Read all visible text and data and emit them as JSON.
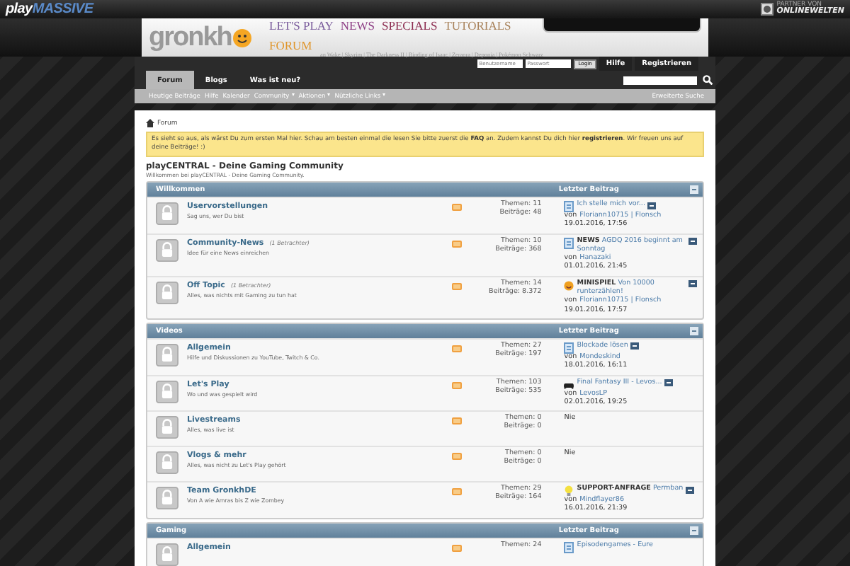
{
  "topbar": {
    "brand_a": "play",
    "brand_b": "MASSIVE",
    "partner_small": "PARTNER VON",
    "partner": "ONLINEWELTEN"
  },
  "header": {
    "logo": "gronkh",
    "nav": [
      {
        "label": "LET'S PLAY",
        "color": "#7a5c9c"
      },
      {
        "label": "NEWS",
        "color": "#8c3c84"
      },
      {
        "label": "SPECIALS",
        "color": "#8c2c50"
      },
      {
        "label": "TUTORIALS",
        "color": "#a8825a"
      },
      {
        "label": "FORUM",
        "color": "#e0962c"
      }
    ],
    "games": "an Wake | Skyrim | The Darkness II | Binding of Isaac | Zeraora | Deponia | Pokémon Schwarz"
  },
  "login": {
    "user_placeholder": "Benutzername",
    "pass_placeholder": "Passwort",
    "button": "Login"
  },
  "top_buttons": [
    "Hilfe",
    "Registrieren"
  ],
  "tabs": [
    {
      "label": "Forum",
      "selected": true
    },
    {
      "label": "Blogs",
      "selected": false
    },
    {
      "label": "Was ist neu?",
      "selected": false
    }
  ],
  "subnav": [
    {
      "label": "Heutige Beiträge",
      "dropdown": false
    },
    {
      "label": "Hilfe",
      "dropdown": false
    },
    {
      "label": "Kalender",
      "dropdown": false
    },
    {
      "label": "Community",
      "dropdown": true
    },
    {
      "label": "Aktionen",
      "dropdown": true
    },
    {
      "label": "Nützliche Links",
      "dropdown": true
    }
  ],
  "advanced_search": "Erweiterte Suche",
  "breadcrumb": "Forum",
  "notice": "Es sieht so aus, als wärst Du zum ersten Mal hier. Schau am besten einmal die lesen Sie bitte zuerst die **FAQ** an. Zudem kannst Du dich hier **registrieren**. Wir freuen uns auf deine Beiträge! :)",
  "title": "playCENTRAL - Deine Gaming Community",
  "subtitle": "Willkommen bei playCENTRAL - Deine Gaming Community.",
  "categories": [
    {
      "name": "Willkommen",
      "last_header": "Letzter Beitrag",
      "forums": [
        {
          "name": "Uservorstellungen",
          "description": "Sag uns, wer Du bist",
          "topics": "Themen: 11",
          "posts": "Beiträge: 48",
          "last": {
            "kind": "document",
            "title": "Ich stelle mich vor...",
            "by_prefix": "von",
            "by": "Floriann10715 | Flonsch",
            "date": "19.01.2016, 17:56"
          }
        },
        {
          "name": "Community-News",
          "viewers": "(1 Betrachter)",
          "description": "Idee für eine News einreichen",
          "topics": "Themen: 10",
          "posts": "Beiträge: 368",
          "last": {
            "kind": "document",
            "title": "**NEWS** AGDQ 2016 beginnt am Sonntag",
            "by_prefix": "von",
            "by": "Hanazaki",
            "date": "01.01.2016, 21:45"
          }
        },
        {
          "name": "Off Topic",
          "viewers": "(1 Betrachter)",
          "description": "Alles, was nichts mit Gaming zu tun hat",
          "topics": "Themen: 14",
          "posts": "Beiträge: 8.372",
          "last": {
            "kind": "smiley",
            "title": "**MINISPIEL** Von 10000 runterzählen!",
            "by_prefix": "von",
            "by": "Floriann10715 | Flonsch",
            "date": "19.01.2016, 17:57"
          }
        }
      ]
    },
    {
      "name": "Videos",
      "last_header": "Letzter Beitrag",
      "forums": [
        {
          "name": "Allgemein",
          "description": "Hilfe und Diskussionen zu YouTube, Twitch & Co.",
          "topics": "Themen: 27",
          "posts": "Beiträge: 197",
          "last": {
            "kind": "document",
            "title": "Blockade lösen",
            "by_prefix": "von",
            "by": "Mondeskind",
            "date": "18.01.2016, 16:11"
          }
        },
        {
          "name": "Let's Play",
          "description": "Wo und was gespielt wird",
          "topics": "Themen: 103",
          "posts": "Beiträge: 535",
          "last": {
            "kind": "gamepad",
            "title": "Final Fantasy III - Levos...",
            "by_prefix": "von",
            "by": "LevosLP",
            "date": "02.01.2016, 19:25"
          }
        },
        {
          "name": "Livestreams",
          "description": "Alles, was live ist",
          "topics": "Themen: 0",
          "posts": "Beiträge: 0",
          "never": "Nie"
        },
        {
          "name": "Vlogs & mehr",
          "description": "Alles, was nicht zu Let's Play gehört",
          "topics": "Themen: 0",
          "posts": "Beiträge: 0",
          "never": "Nie"
        },
        {
          "name": "Team GronkhDE",
          "description": "Von A wie Amras bis Z wie Zombey",
          "topics": "Themen: 29",
          "posts": "Beiträge: 164",
          "last": {
            "kind": "bulb",
            "title": "**SUPPORT-ANFRAGE** Permban",
            "by_prefix": "von",
            "by": "Mindflayer86",
            "date": "16.01.2016, 21:39"
          }
        }
      ]
    },
    {
      "name": "Gaming",
      "last_header": "Letzter Beitrag",
      "forums": [
        {
          "name": "Allgemein",
          "topics": "Themen: 24",
          "last": {
            "kind": "document",
            "title": "Episodengames - Eure"
          }
        }
      ]
    }
  ]
}
